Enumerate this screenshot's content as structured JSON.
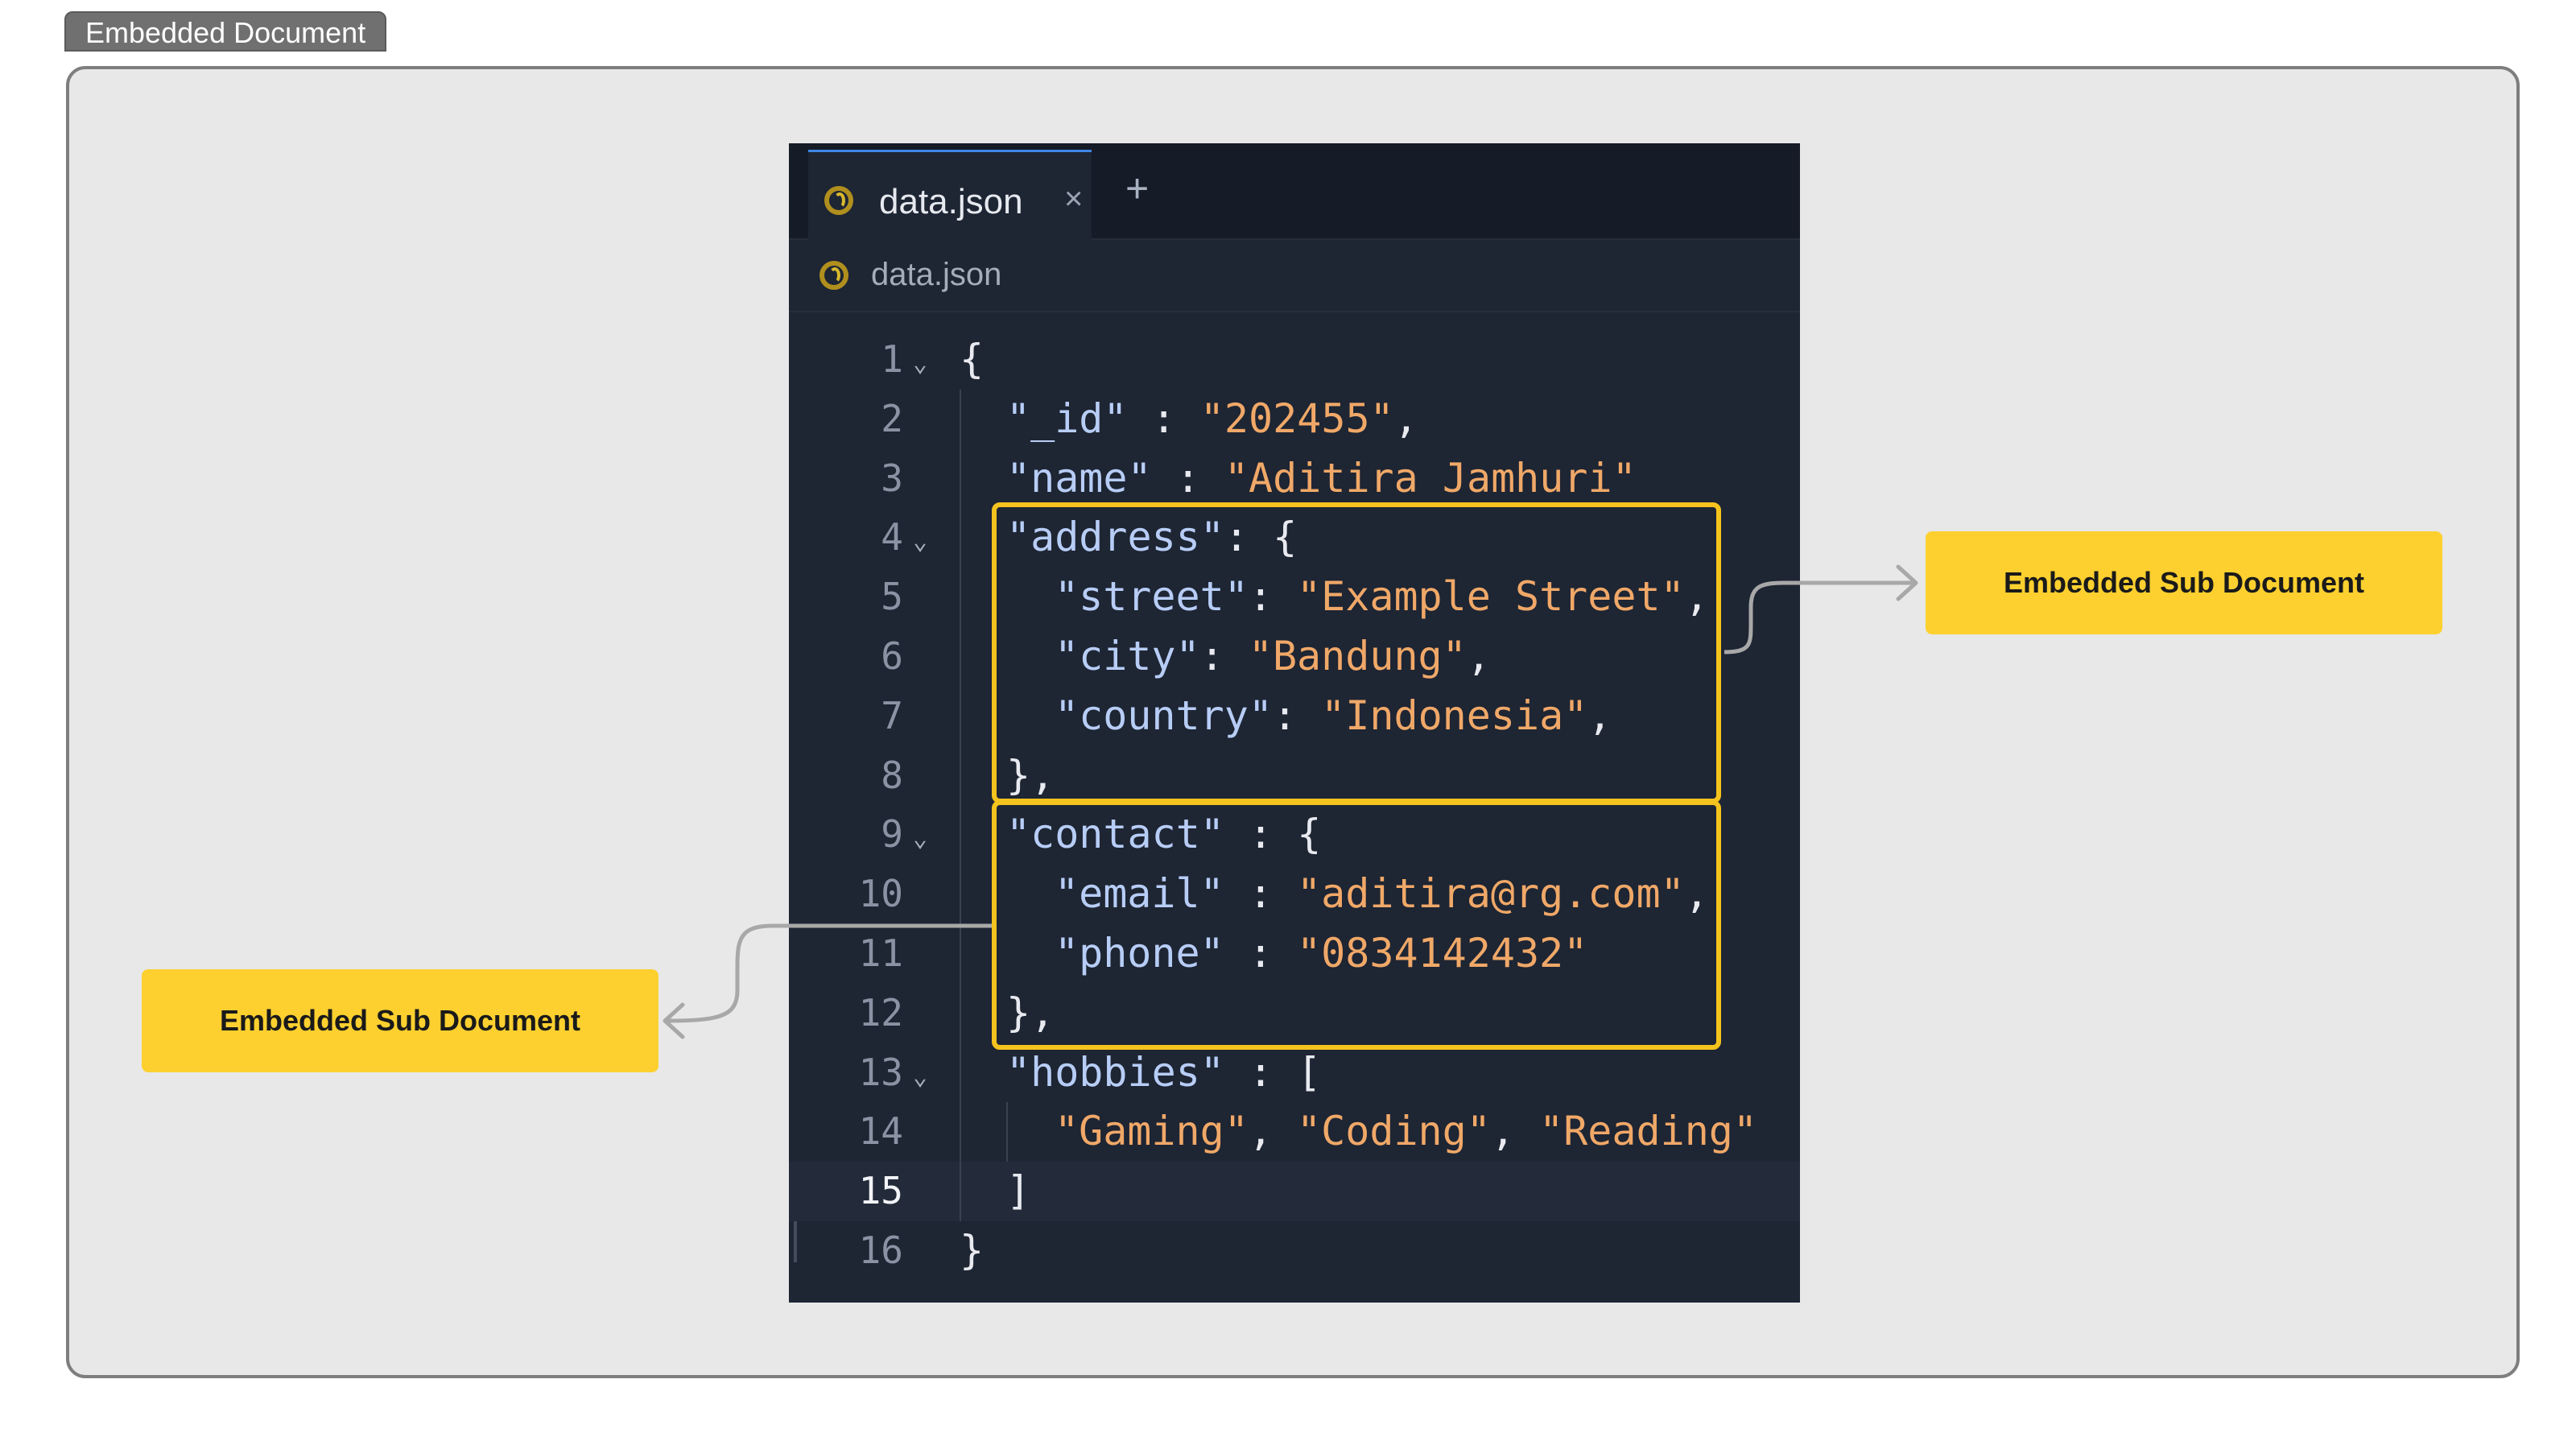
{
  "frame": {
    "title": "Embedded Document"
  },
  "editor": {
    "tab": {
      "label": "data.json",
      "close_glyph": "×",
      "add_glyph": "+"
    },
    "breadcrumb": "data.json",
    "current_line": 15,
    "lines": [
      {
        "num": "1",
        "fold": true,
        "indent": 0,
        "parts": [
          {
            "t": "{",
            "c": "p"
          }
        ]
      },
      {
        "num": "2",
        "fold": false,
        "indent": 1,
        "parts": [
          {
            "t": "\"_id\"",
            "c": "k"
          },
          {
            "t": " : ",
            "c": "p"
          },
          {
            "t": "\"202455\"",
            "c": "s"
          },
          {
            "t": ",",
            "c": "p"
          }
        ]
      },
      {
        "num": "3",
        "fold": false,
        "indent": 1,
        "parts": [
          {
            "t": "\"name\"",
            "c": "k"
          },
          {
            "t": " : ",
            "c": "p"
          },
          {
            "t": "\"Aditira Jamhuri\"",
            "c": "s"
          }
        ]
      },
      {
        "num": "4",
        "fold": true,
        "indent": 1,
        "parts": [
          {
            "t": "\"address\"",
            "c": "k"
          },
          {
            "t": ": {",
            "c": "p"
          }
        ]
      },
      {
        "num": "5",
        "fold": false,
        "indent": 2,
        "parts": [
          {
            "t": "\"street\"",
            "c": "k"
          },
          {
            "t": ": ",
            "c": "p"
          },
          {
            "t": "\"Example Street\"",
            "c": "s"
          },
          {
            "t": ",",
            "c": "p"
          }
        ]
      },
      {
        "num": "6",
        "fold": false,
        "indent": 2,
        "parts": [
          {
            "t": "\"city\"",
            "c": "k"
          },
          {
            "t": ": ",
            "c": "p"
          },
          {
            "t": "\"Bandung\"",
            "c": "s"
          },
          {
            "t": ",",
            "c": "p"
          }
        ]
      },
      {
        "num": "7",
        "fold": false,
        "indent": 2,
        "parts": [
          {
            "t": "\"country\"",
            "c": "k"
          },
          {
            "t": ": ",
            "c": "p"
          },
          {
            "t": "\"Indonesia\"",
            "c": "s"
          },
          {
            "t": ",",
            "c": "p"
          }
        ]
      },
      {
        "num": "8",
        "fold": false,
        "indent": 1,
        "parts": [
          {
            "t": "},",
            "c": "p"
          }
        ]
      },
      {
        "num": "9",
        "fold": true,
        "indent": 1,
        "parts": [
          {
            "t": "\"contact\"",
            "c": "k"
          },
          {
            "t": " : {",
            "c": "p"
          }
        ]
      },
      {
        "num": "10",
        "fold": false,
        "indent": 2,
        "parts": [
          {
            "t": "\"email\"",
            "c": "k"
          },
          {
            "t": " : ",
            "c": "p"
          },
          {
            "t": "\"aditira@rg.com\"",
            "c": "s"
          },
          {
            "t": ",",
            "c": "p"
          }
        ]
      },
      {
        "num": "11",
        "fold": false,
        "indent": 2,
        "parts": [
          {
            "t": "\"phone\"",
            "c": "k"
          },
          {
            "t": " : ",
            "c": "p"
          },
          {
            "t": "\"0834142432\"",
            "c": "s"
          }
        ]
      },
      {
        "num": "12",
        "fold": false,
        "indent": 1,
        "parts": [
          {
            "t": "},",
            "c": "p"
          }
        ]
      },
      {
        "num": "13",
        "fold": true,
        "indent": 1,
        "parts": [
          {
            "t": "\"hobbies\"",
            "c": "k"
          },
          {
            "t": " : [",
            "c": "p"
          }
        ]
      },
      {
        "num": "14",
        "fold": false,
        "indent": 2,
        "parts": [
          {
            "t": "\"Gaming\"",
            "c": "s"
          },
          {
            "t": ", ",
            "c": "p"
          },
          {
            "t": "\"Coding\"",
            "c": "s"
          },
          {
            "t": ", ",
            "c": "p"
          },
          {
            "t": "\"Reading\"",
            "c": "s"
          }
        ]
      },
      {
        "num": "15",
        "fold": false,
        "indent": 1,
        "parts": [
          {
            "t": "]",
            "c": "p"
          }
        ]
      },
      {
        "num": "16",
        "fold": false,
        "indent": 0,
        "parts": [
          {
            "t": "}",
            "c": "p"
          }
        ]
      }
    ]
  },
  "callouts": {
    "address": "Embedded Sub Document",
    "contact": "Embedded Sub Document"
  },
  "colors": {
    "highlight": "#f5c31e",
    "callout_bg": "#fdd02f",
    "editor_bg": "#1e2533",
    "json_key": "#b7cdf6",
    "json_string": "#f0a868",
    "connector": "#a8a8a8"
  }
}
